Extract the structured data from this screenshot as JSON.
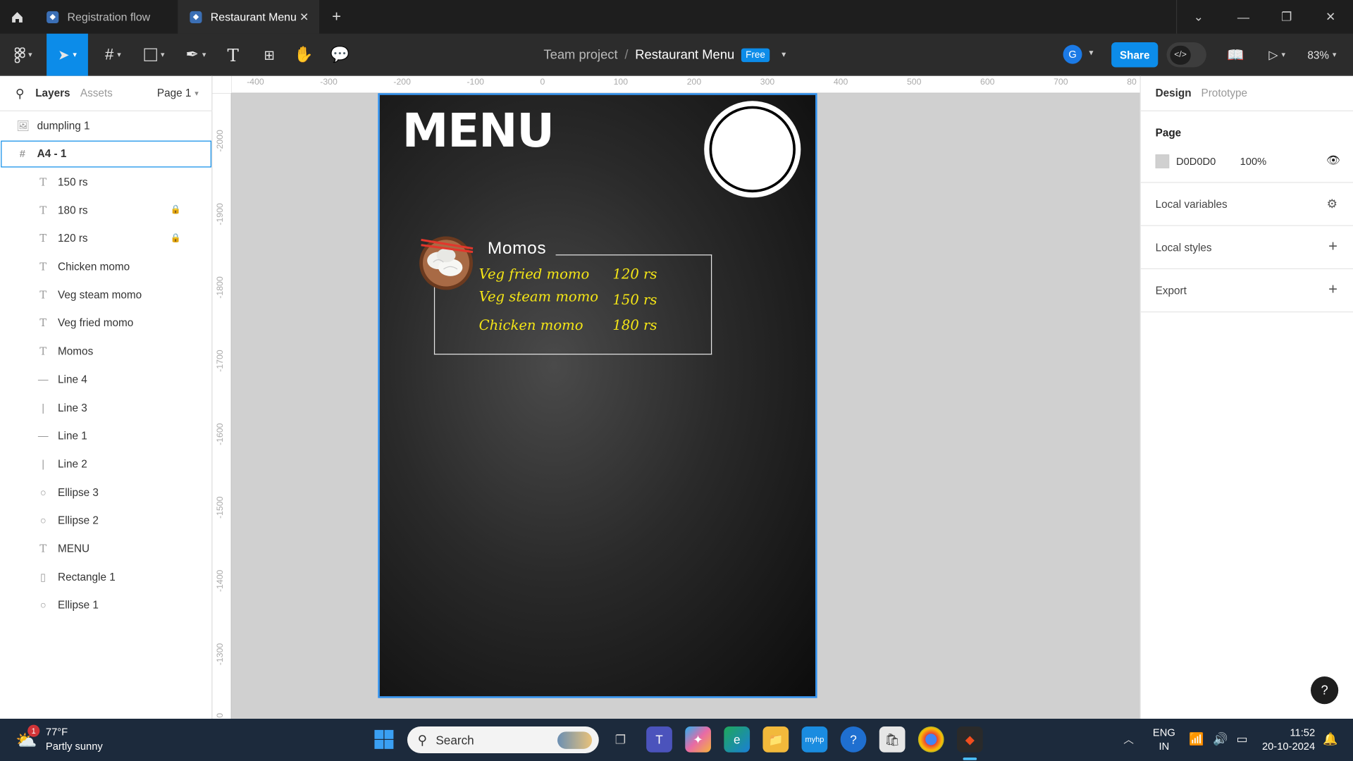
{
  "tabs": [
    {
      "label": "Registration flow",
      "active": false
    },
    {
      "label": "Restaurant Menu",
      "active": true
    }
  ],
  "breadcrumb": {
    "team": "Team project",
    "separator": "/",
    "file": "Restaurant Menu",
    "badge": "Free"
  },
  "toolbar": {
    "share_label": "Share",
    "zoom": "83%",
    "avatar": "G"
  },
  "left_panel": {
    "tab_layers": "Layers",
    "tab_assets": "Assets",
    "page_selector": "Page 1",
    "layers": [
      {
        "name": "dumpling 1",
        "icon": "image-icon",
        "level": 0,
        "locked": false,
        "selected": false
      },
      {
        "name": "A4 - 1",
        "icon": "frame-icon",
        "level": 0,
        "locked": false,
        "selected": true
      },
      {
        "name": "150 rs",
        "icon": "text-icon",
        "level": 1,
        "locked": false,
        "selected": false
      },
      {
        "name": "180 rs",
        "icon": "text-icon",
        "level": 1,
        "locked": true,
        "selected": false
      },
      {
        "name": "120 rs",
        "icon": "text-icon",
        "level": 1,
        "locked": true,
        "selected": false
      },
      {
        "name": "Chicken momo",
        "icon": "text-icon",
        "level": 1,
        "locked": false,
        "selected": false
      },
      {
        "name": "Veg steam momo",
        "icon": "text-icon",
        "level": 1,
        "locked": false,
        "selected": false
      },
      {
        "name": "Veg fried momo",
        "icon": "text-icon",
        "level": 1,
        "locked": false,
        "selected": false
      },
      {
        "name": "Momos",
        "icon": "text-icon",
        "level": 1,
        "locked": false,
        "selected": false
      },
      {
        "name": "Line 4",
        "icon": "line-h-icon",
        "level": 1,
        "locked": false,
        "selected": false
      },
      {
        "name": "Line 3",
        "icon": "line-v-icon",
        "level": 1,
        "locked": false,
        "selected": false
      },
      {
        "name": "Line 1",
        "icon": "line-h-icon",
        "level": 1,
        "locked": false,
        "selected": false
      },
      {
        "name": "Line 2",
        "icon": "line-v-icon",
        "level": 1,
        "locked": false,
        "selected": false
      },
      {
        "name": "Ellipse 3",
        "icon": "ellipse-icon",
        "level": 1,
        "locked": false,
        "selected": false
      },
      {
        "name": "Ellipse 2",
        "icon": "ellipse-icon",
        "level": 1,
        "locked": false,
        "selected": false
      },
      {
        "name": "MENU",
        "icon": "text-icon",
        "level": 1,
        "locked": false,
        "selected": false
      },
      {
        "name": "Rectangle 1",
        "icon": "rectangle-icon",
        "level": 1,
        "locked": false,
        "selected": false
      },
      {
        "name": "Ellipse 1",
        "icon": "ellipse-icon",
        "level": 1,
        "locked": false,
        "selected": false
      }
    ]
  },
  "rulers": {
    "h": [
      "-400",
      "-300",
      "-200",
      "-100",
      "0",
      "100",
      "200",
      "300",
      "400",
      "500",
      "600",
      "700",
      "80"
    ],
    "v": [
      "-2000",
      "-1900",
      "-1800",
      "-1700",
      "-1600",
      "-1500",
      "-1400",
      "-1300",
      "0"
    ]
  },
  "canvas": {
    "menu_title": "MENU",
    "section_title": "Momos",
    "items": [
      {
        "name": "Veg fried momo",
        "price": "120 rs"
      },
      {
        "name": "Veg steam momo",
        "price": "150 rs"
      },
      {
        "name": "Chicken momo",
        "price": "180 rs"
      }
    ],
    "colors": {
      "frame_bg": "#1e1e1e",
      "item_text": "#f5e616",
      "selection": "#2b8ff0",
      "canvas_bg": "#d0d0d0"
    }
  },
  "right_panel": {
    "tab_design": "Design",
    "tab_prototype": "Prototype",
    "page_heading": "Page",
    "page_color": "D0D0D0",
    "page_opacity": "100%",
    "local_variables": "Local variables",
    "local_styles": "Local styles",
    "export": "Export"
  },
  "taskbar": {
    "weather_temp": "77°F",
    "weather_desc": "Partly sunny",
    "weather_badge": "1",
    "search_placeholder": "Search",
    "lang_top": "ENG",
    "lang_bottom": "IN",
    "time": "11:52",
    "date": "20-10-2024"
  }
}
